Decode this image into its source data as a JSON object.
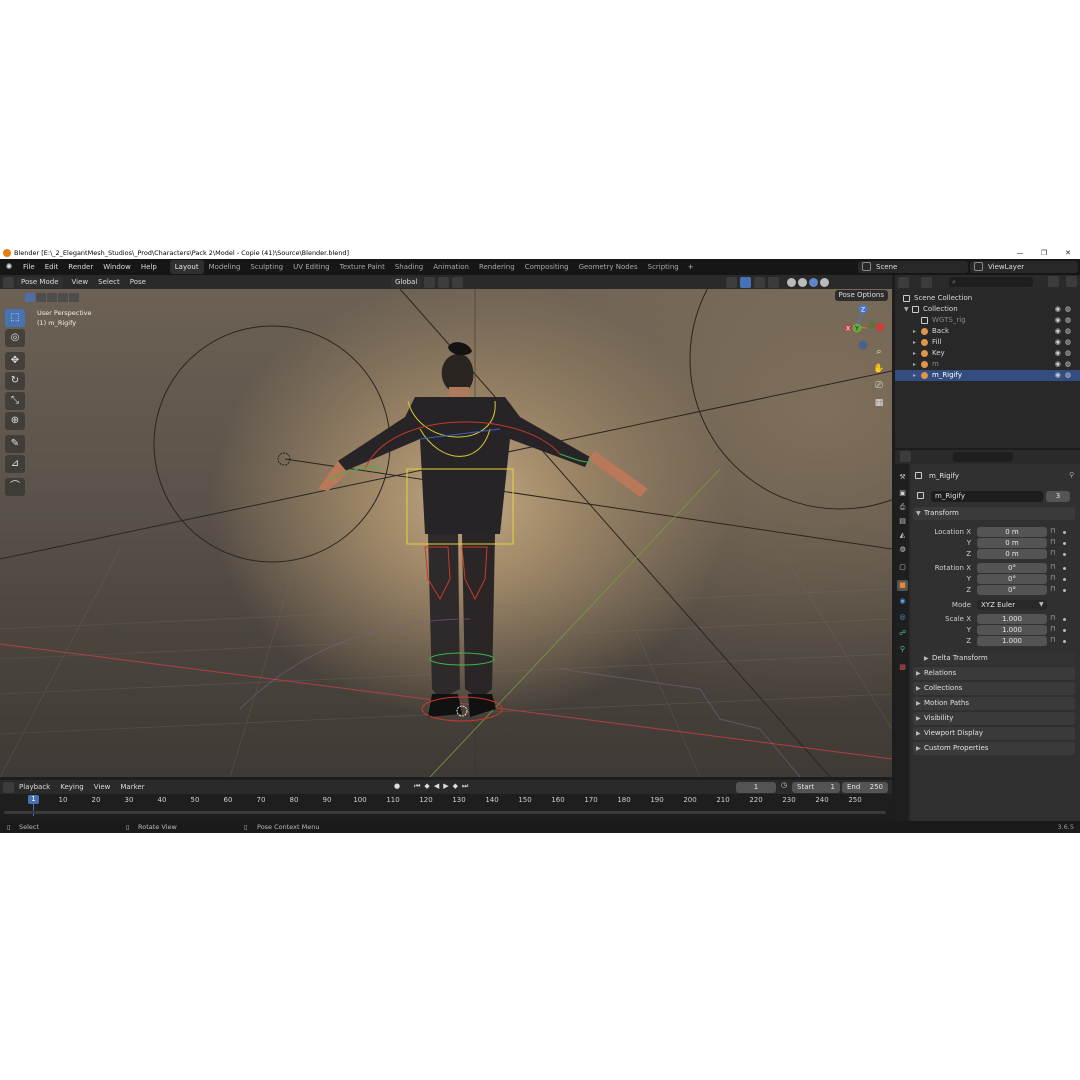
{
  "window": {
    "title": "Blender [E:\\_2_ElegantMesh_Studios\\_Prod\\Characters\\Pack 2\\Model - Copie (41)\\Source\\Blender.blend]",
    "controls": [
      "—",
      "❐",
      "✕"
    ]
  },
  "menubar": {
    "items": [
      "File",
      "Edit",
      "Render",
      "Window",
      "Help"
    ],
    "workspaces": [
      "Layout",
      "Modeling",
      "Sculpting",
      "UV Editing",
      "Texture Paint",
      "Shading",
      "Animation",
      "Rendering",
      "Compositing",
      "Geometry Nodes",
      "Scripting"
    ],
    "active_workspace": "Layout",
    "add_workspace": "+",
    "scene": "Scene",
    "view_layer": "ViewLayer"
  },
  "viewport_header": {
    "mode": "Pose Mode",
    "menus": [
      "View",
      "Select",
      "Pose"
    ],
    "orientation": "Global",
    "pose_options": "Pose Options"
  },
  "viewport": {
    "perspective": "User Perspective",
    "object": "(1) m_Rigify",
    "gizmo": {
      "z": "Z",
      "y": "Y",
      "x": "X"
    },
    "accent": "#4772b3"
  },
  "timeline": {
    "menus": [
      "Playback",
      "Keying",
      "View",
      "Marker"
    ],
    "current_frame": "1",
    "start_label": "Start",
    "start": "1",
    "end_label": "End",
    "end": "250",
    "ticks": [
      "10",
      "20",
      "30",
      "40",
      "50",
      "60",
      "70",
      "80",
      "90",
      "100",
      "110",
      "120",
      "130",
      "140",
      "150",
      "160",
      "170",
      "180",
      "190",
      "200",
      "210",
      "220",
      "230",
      "240",
      "250"
    ],
    "playhead": "1"
  },
  "statusbar": {
    "select": "Select",
    "rotate": "Rotate View",
    "context": "Pose Context Menu",
    "version": "3.6.5"
  },
  "outliner": {
    "rows": [
      {
        "label": "Scene Collection",
        "indent": 0
      },
      {
        "label": "Collection",
        "indent": 1
      },
      {
        "label": "WGTS_rig",
        "indent": 2
      },
      {
        "label": "Back",
        "indent": 2
      },
      {
        "label": "Fill",
        "indent": 2
      },
      {
        "label": "Key",
        "indent": 2
      },
      {
        "label": "m",
        "indent": 2
      },
      {
        "label": "m_Rigify",
        "indent": 2
      }
    ],
    "selected": "m_Rigify"
  },
  "properties": {
    "object_name": "m_Rigify",
    "data_name": "m_Rigify",
    "users": "3",
    "transform_label": "Transform",
    "location": {
      "label": "Location X",
      "x": "0 m",
      "y": "0 m",
      "z": "0 m"
    },
    "rotation": {
      "label": "Rotation X",
      "x": "0°",
      "y": "0°",
      "z": "0°"
    },
    "mode_label": "Mode",
    "mode": "XYZ Euler",
    "scale": {
      "label": "Scale X",
      "x": "1.000",
      "y": "1.000",
      "z": "1.000"
    },
    "axis_y": "Y",
    "axis_z": "Z",
    "delta_transform": "Delta Transform",
    "panels": [
      "Relations",
      "Collections",
      "Motion Paths",
      "Visibility",
      "Viewport Display",
      "Custom Properties"
    ]
  }
}
